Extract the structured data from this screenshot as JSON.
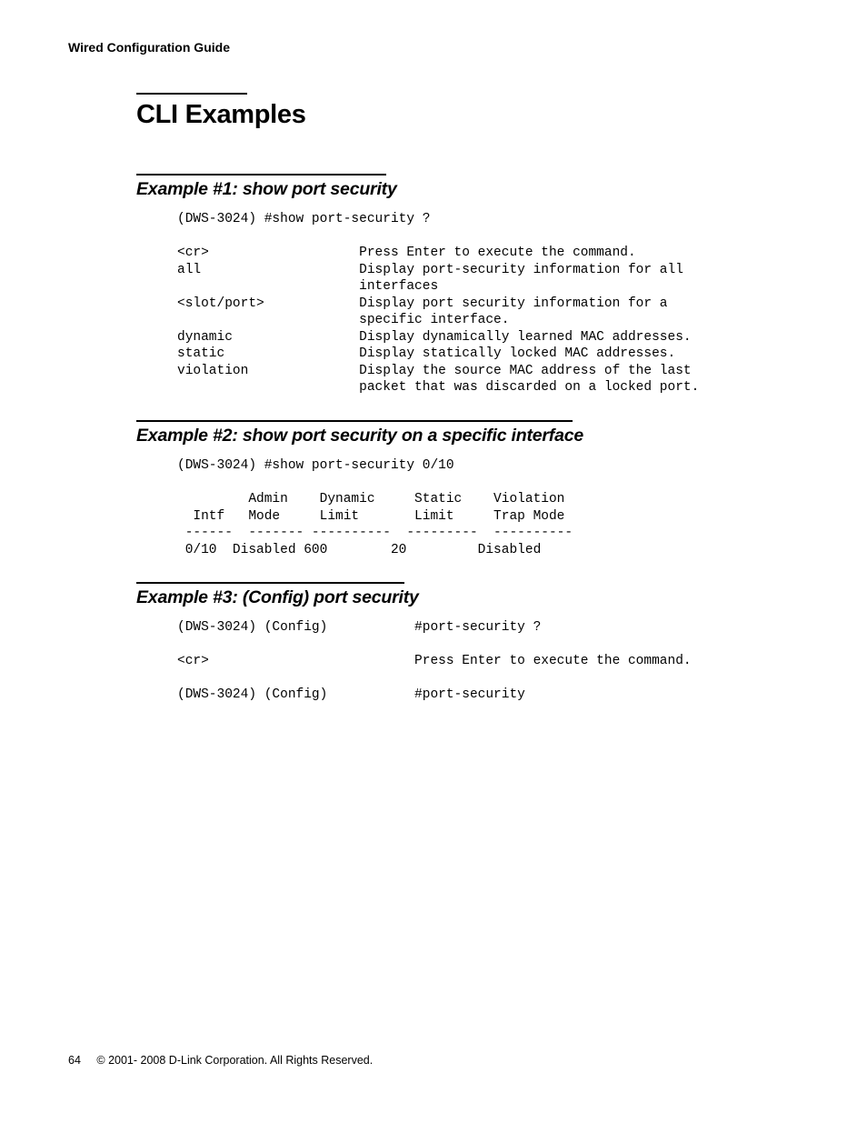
{
  "header": "Wired Configuration Guide",
  "title": "CLI Examples",
  "ex1": {
    "heading": "Example #1: show port security",
    "cmd": "(DWS-3024) #show port-security ?",
    "rows": [
      {
        "k": "<cr>",
        "v": "Press Enter to execute the command."
      },
      {
        "k": "all",
        "v": "Display port-security information for all\n                       interfaces"
      },
      {
        "k": "<slot/port>",
        "v": "Display port security information for a\n                       specific interface."
      },
      {
        "k": "dynamic",
        "v": "Display dynamically learned MAC addresses."
      },
      {
        "k": "static",
        "v": "Display statically locked MAC addresses."
      },
      {
        "k": "violation",
        "v": "Display the source MAC address of the last\n                       packet that was discarded on a locked port."
      }
    ]
  },
  "ex2": {
    "heading": "Example #2: show port security on a specific interface",
    "cmd": "(DWS-3024) #show port-security 0/10",
    "table": "         Admin    Dynamic     Static    Violation\n  Intf   Mode     Limit       Limit     Trap Mode\n ------  ------- ----------  ---------  ----------\n 0/10  Disabled 600        20         Disabled"
  },
  "ex3": {
    "heading": "Example #3: (Config) port security",
    "lines": [
      {
        "l": "(DWS-3024) (Config)",
        "r": "#port-security ?"
      },
      {
        "l": "<cr>",
        "r": "Press Enter to execute the command."
      },
      {
        "l": "(DWS-3024) (Config)",
        "r": "#port-security"
      }
    ]
  },
  "footer": {
    "page": "64",
    "copy": "© 2001- 2008 D-Link Corporation. All Rights Reserved."
  }
}
